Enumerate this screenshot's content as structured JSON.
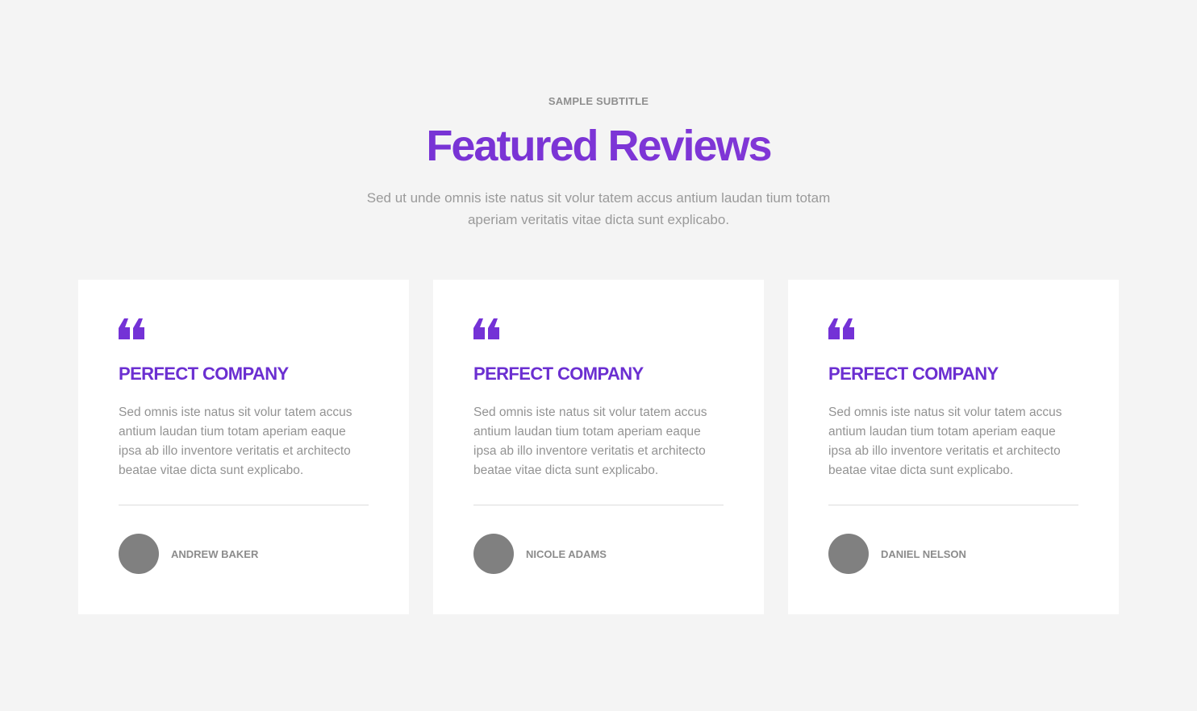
{
  "header": {
    "subtitle": "SAMPLE SUBTITLE",
    "title": "Featured Reviews",
    "lead": "Sed ut unde omnis iste natus sit volur tatem accus antium laudan tium totam aperiam veritatis vitae dicta sunt explicabo."
  },
  "colors": {
    "accent": "#7432d6",
    "background": "#f4f4f4",
    "card": "#ffffff",
    "avatar": "#808080"
  },
  "reviews": [
    {
      "icon": "quote-icon",
      "title": "PERFECT COMPANY",
      "text": "Sed omnis iste natus sit volur tatem accus antium laudan tium totam aperiam eaque ipsa ab illo inventore veritatis et architecto beatae vitae dicta sunt explicabo.",
      "author": "ANDREW BAKER"
    },
    {
      "icon": "quote-icon",
      "title": "PERFECT COMPANY",
      "text": "Sed omnis iste natus sit volur tatem accus antium laudan tium totam aperiam eaque ipsa ab illo inventore veritatis et architecto beatae vitae dicta sunt explicabo.",
      "author": "NICOLE ADAMS"
    },
    {
      "icon": "quote-icon",
      "title": "PERFECT COMPANY",
      "text": "Sed omnis iste natus sit volur tatem accus antium laudan tium totam aperiam eaque ipsa ab illo inventore veritatis et architecto beatae vitae dicta sunt explicabo.",
      "author": "DANIEL NELSON"
    }
  ]
}
